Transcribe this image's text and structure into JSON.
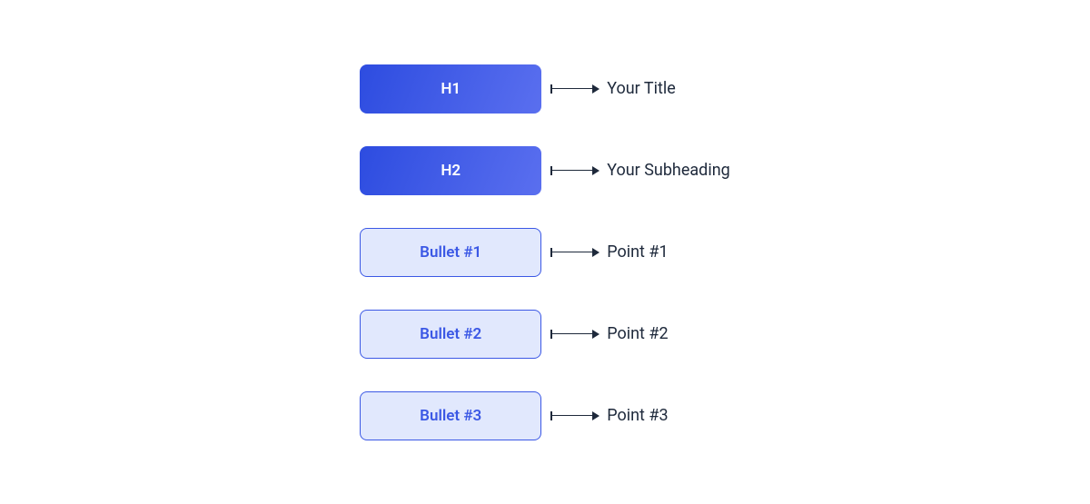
{
  "rows": [
    {
      "box_label": "H1",
      "box_style": "header",
      "description": "Your Title"
    },
    {
      "box_label": "H2",
      "box_style": "header",
      "description": "Your Subheading"
    },
    {
      "box_label": "Bullet #1",
      "box_style": "bullet",
      "description": "Point #1"
    },
    {
      "box_label": "Bullet #2",
      "box_style": "bullet",
      "description": "Point #2"
    },
    {
      "box_label": "Bullet #3",
      "box_style": "bullet",
      "description": "Point #3"
    }
  ]
}
